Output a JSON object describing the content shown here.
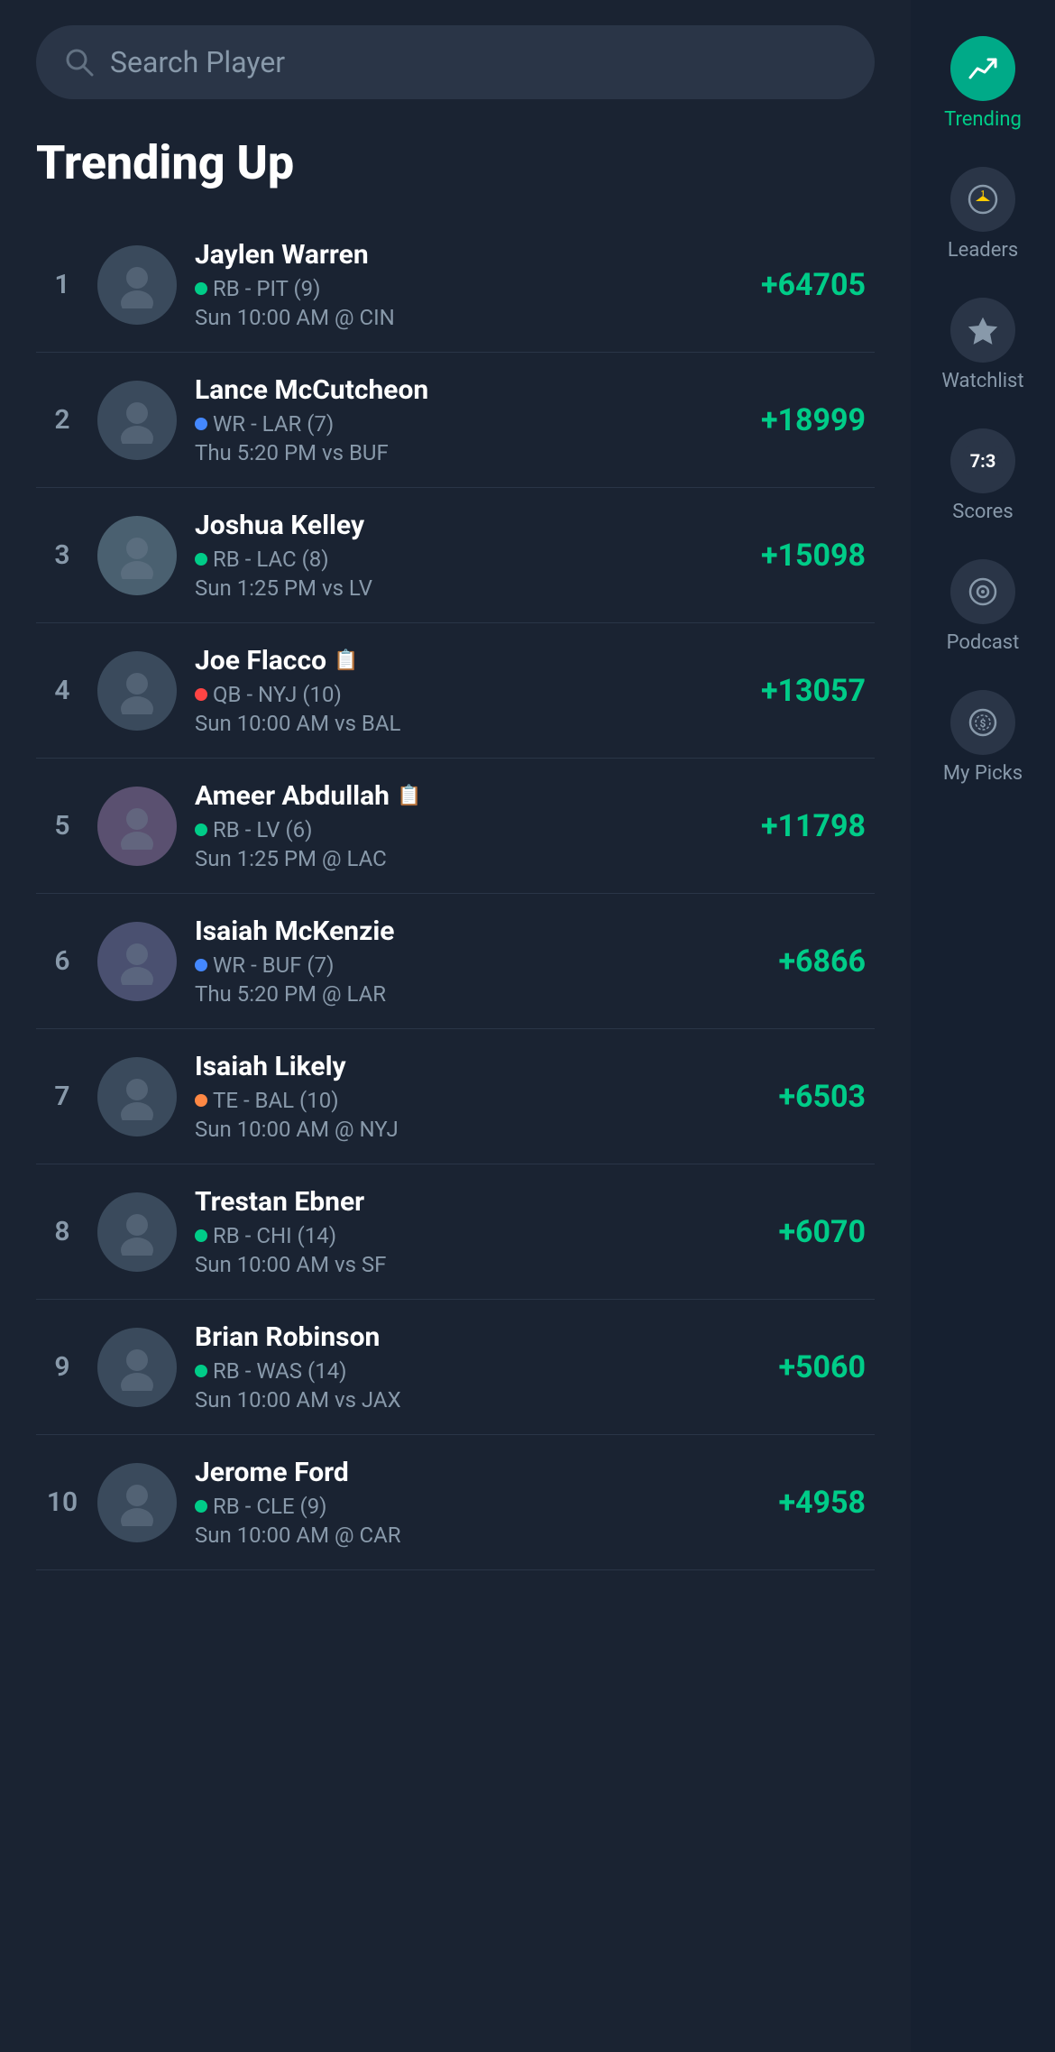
{
  "search": {
    "placeholder": "Search Player"
  },
  "section": {
    "title": "Trending Up"
  },
  "sidebar": {
    "items": [
      {
        "id": "trending",
        "label": "Trending",
        "active": true,
        "icon": "trending"
      },
      {
        "id": "leaders",
        "label": "Leaders",
        "active": false,
        "icon": "leaders"
      },
      {
        "id": "watchlist",
        "label": "Watchlist",
        "active": false,
        "icon": "watchlist"
      },
      {
        "id": "scores",
        "label": "Scores",
        "active": false,
        "icon": "scores",
        "badge": "7:3"
      },
      {
        "id": "podcast",
        "label": "Podcast",
        "active": false,
        "icon": "podcast"
      },
      {
        "id": "mypicks",
        "label": "My Picks",
        "active": false,
        "icon": "mypicks"
      }
    ]
  },
  "players": [
    {
      "rank": "1",
      "name": "Jaylen Warren",
      "position": "RB",
      "team": "PIT",
      "week": "9",
      "schedule": "Sun 10:00 AM @ CIN",
      "score": "+64705",
      "statusColor": "green",
      "hasNote": false,
      "avatarColor": "#3a4a5c"
    },
    {
      "rank": "2",
      "name": "Lance McCutcheon",
      "position": "WR",
      "team": "LAR",
      "week": "7",
      "schedule": "Thu 5:20 PM vs BUF",
      "score": "+18999",
      "statusColor": "blue",
      "hasNote": false,
      "avatarColor": "#3a4a5c"
    },
    {
      "rank": "3",
      "name": "Joshua Kelley",
      "position": "RB",
      "team": "LAC",
      "week": "8",
      "schedule": "Sun 1:25 PM vs LV",
      "score": "+15098",
      "statusColor": "green",
      "hasNote": false,
      "avatarColor": "#4a6070"
    },
    {
      "rank": "4",
      "name": "Joe Flacco",
      "position": "QB",
      "team": "NYJ",
      "week": "10",
      "schedule": "Sun 10:00 AM vs BAL",
      "score": "+13057",
      "statusColor": "red",
      "hasNote": true,
      "avatarColor": "#3a4a5c"
    },
    {
      "rank": "5",
      "name": "Ameer Abdullah",
      "position": "RB",
      "team": "LV",
      "week": "6",
      "schedule": "Sun 1:25 PM @ LAC",
      "score": "+11798",
      "statusColor": "green",
      "hasNote": true,
      "avatarColor": "#5a5070"
    },
    {
      "rank": "6",
      "name": "Isaiah McKenzie",
      "position": "WR",
      "team": "BUF",
      "week": "7",
      "schedule": "Thu 5:20 PM @ LAR",
      "score": "+6866",
      "statusColor": "blue",
      "hasNote": false,
      "avatarColor": "#4a5070"
    },
    {
      "rank": "7",
      "name": "Isaiah Likely",
      "position": "TE",
      "team": "BAL",
      "week": "10",
      "schedule": "Sun 10:00 AM @ NYJ",
      "score": "+6503",
      "statusColor": "orange",
      "hasNote": false,
      "avatarColor": "#3a4a5c"
    },
    {
      "rank": "8",
      "name": "Trestan Ebner",
      "position": "RB",
      "team": "CHI",
      "week": "14",
      "schedule": "Sun 10:00 AM vs SF",
      "score": "+6070",
      "statusColor": "green",
      "hasNote": false,
      "avatarColor": "#3a4a5c"
    },
    {
      "rank": "9",
      "name": "Brian Robinson",
      "position": "RB",
      "team": "WAS",
      "week": "14",
      "schedule": "Sun 10:00 AM vs JAX",
      "score": "+5060",
      "statusColor": "green",
      "hasNote": false,
      "avatarColor": "#3a4a5c"
    },
    {
      "rank": "10",
      "name": "Jerome Ford",
      "position": "RB",
      "team": "CLE",
      "week": "9",
      "schedule": "Sun 10:00 AM @ CAR",
      "score": "+4958",
      "statusColor": "green",
      "hasNote": false,
      "avatarColor": "#3a4a5c"
    }
  ]
}
